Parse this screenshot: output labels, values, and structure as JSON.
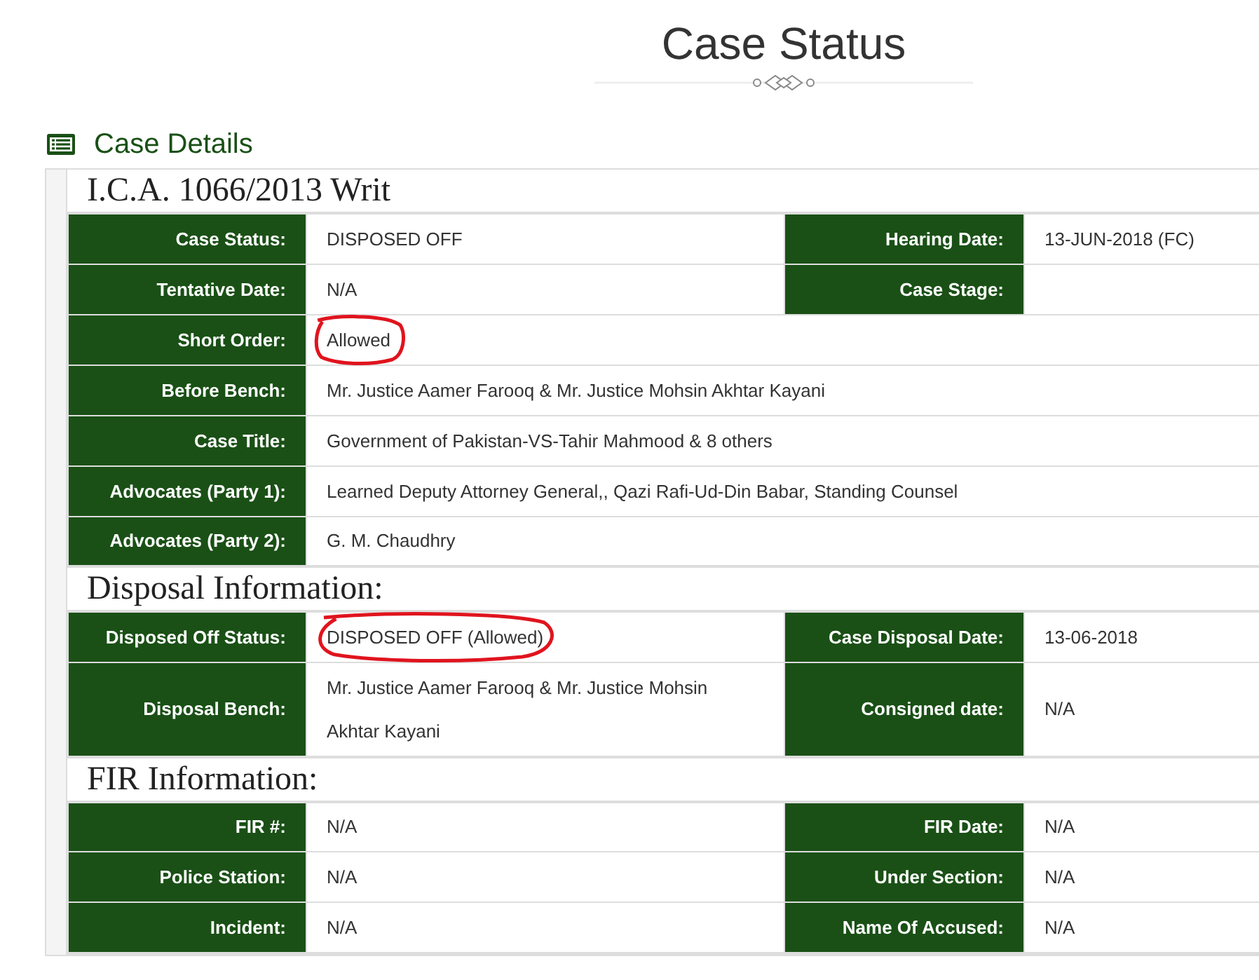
{
  "page_title": "Case Status",
  "section": {
    "title": "Case Details"
  },
  "groups": [
    {
      "heading": "I.C.A. 1066/2013 Writ",
      "rows": [
        {
          "cells": [
            {
              "label": "Case Status:",
              "value": "DISPOSED OFF"
            },
            {
              "label": "Hearing Date:",
              "value": "13-JUN-2018 (FC)"
            }
          ]
        },
        {
          "cells": [
            {
              "label": "Tentative Date:",
              "value": "N/A"
            },
            {
              "label": "Case Stage:"
            }
          ]
        },
        {
          "cells": [
            {
              "label": "Short Order:",
              "value": "Allowed",
              "circled": true
            }
          ]
        },
        {
          "cells": [
            {
              "label": "Before Bench:",
              "value": "Mr. Justice Aamer Farooq & Mr. Justice Mohsin Akhtar Kayani"
            }
          ]
        },
        {
          "cells": [
            {
              "label": "Case Title:",
              "value": "Government of Pakistan-VS-Tahir Mahmood & 8 others"
            }
          ]
        },
        {
          "cells": [
            {
              "label": "Advocates (Party 1):",
              "value": "Learned Deputy Attorney General,, Qazi Rafi-Ud-Din Babar, Standing Counsel"
            }
          ]
        },
        {
          "cells": [
            {
              "label": "Advocates (Party 2):",
              "value": "G. M. Chaudhry"
            }
          ]
        }
      ]
    },
    {
      "heading": "Disposal Information:",
      "rows": [
        {
          "cells": [
            {
              "label": "Disposed Off Status:",
              "value": "DISPOSED OFF (Allowed)",
              "circled": true
            },
            {
              "label": "Case Disposal Date:",
              "value": "13-06-2018"
            }
          ]
        },
        {
          "cells": [
            {
              "label": "Disposal Bench:",
              "value": "Mr. Justice Aamer Farooq & Mr. Justice Mohsin Akhtar Kayani"
            },
            {
              "label": "Consigned date:",
              "value": "N/A"
            }
          ]
        }
      ]
    },
    {
      "heading": "FIR Information:",
      "rows": [
        {
          "cells": [
            {
              "label": "FIR #:",
              "value": "N/A"
            },
            {
              "label": "FIR Date:",
              "value": "N/A"
            }
          ]
        },
        {
          "cells": [
            {
              "label": "Police Station:",
              "value": "N/A"
            },
            {
              "label": "Under Section:",
              "value": "N/A"
            }
          ]
        },
        {
          "cells": [
            {
              "label": "Incident:",
              "value": "N/A"
            },
            {
              "label": "Name Of Accused:",
              "value": "N/A"
            }
          ]
        }
      ]
    }
  ]
}
